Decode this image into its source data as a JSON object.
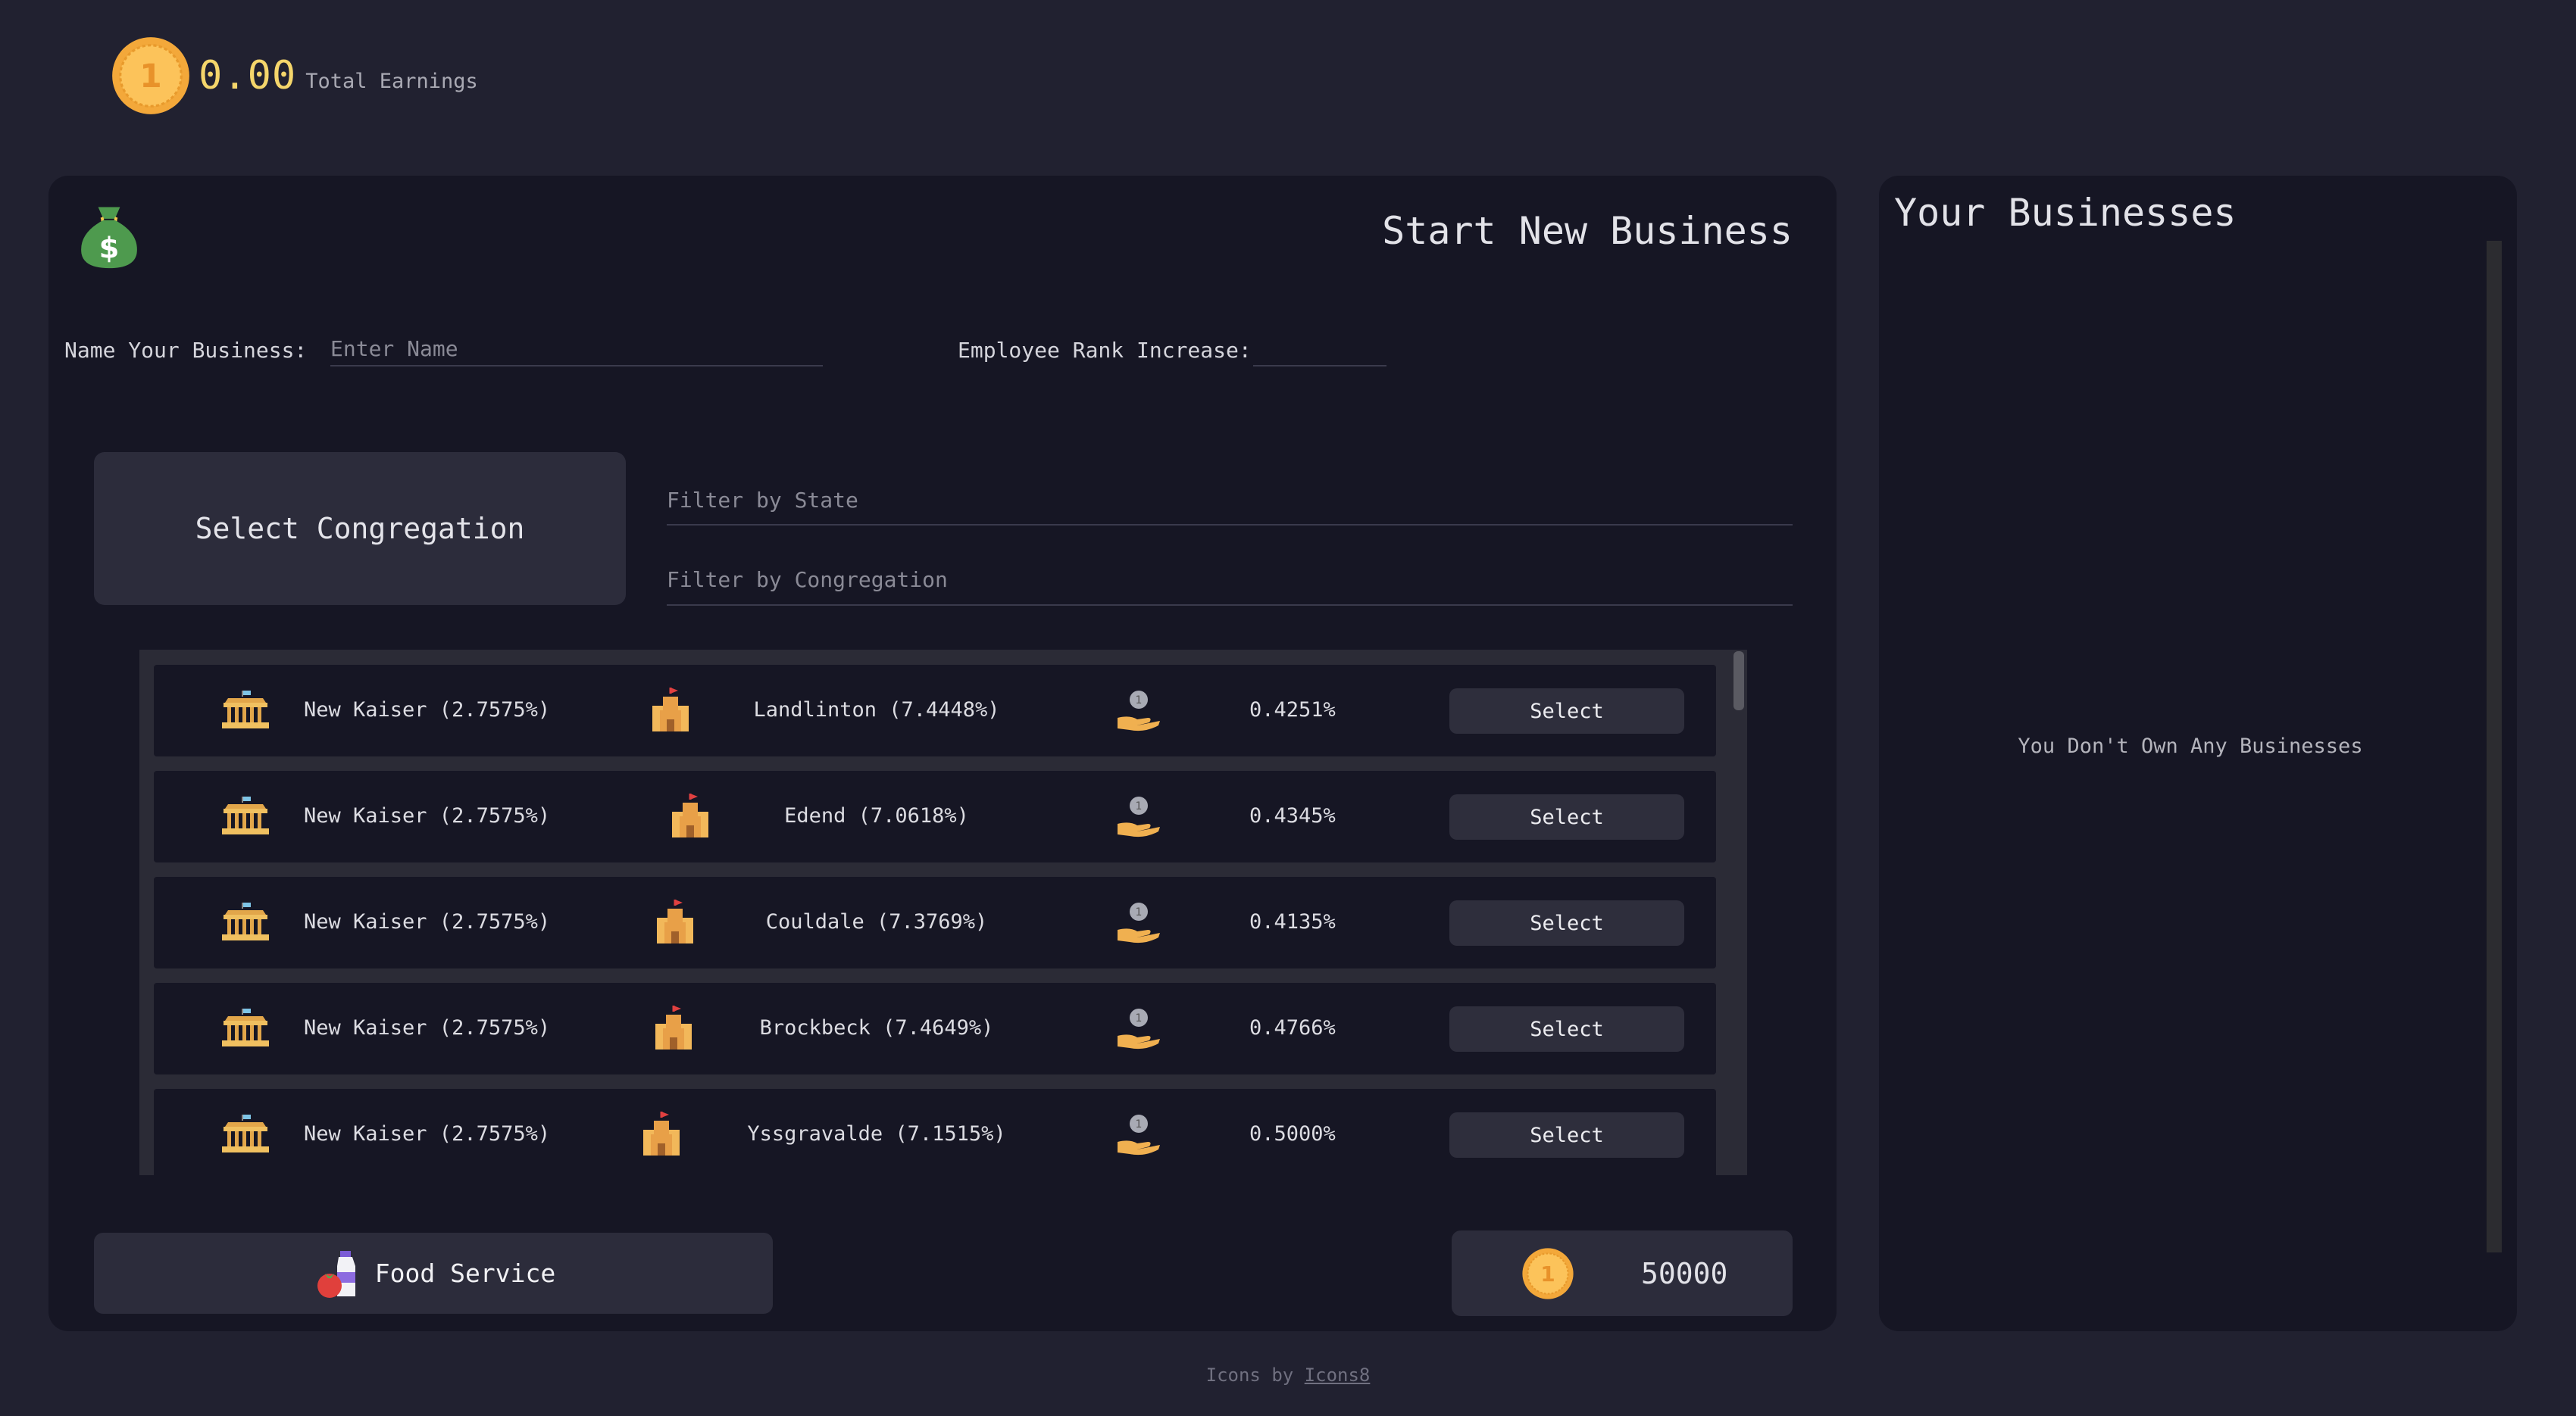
{
  "earnings": {
    "amount": "0.00",
    "label": "Total Earnings",
    "coin_icon": "coin-icon"
  },
  "start": {
    "title": "Start New Business",
    "name_label": "Name Your Business:",
    "name_placeholder": "Enter Name",
    "name_value": "",
    "rank_label": "Employee Rank Increase:",
    "rank_value": "",
    "congregation_button": "Select Congregation",
    "filter_state_placeholder": "Filter by State",
    "filter_congregation_placeholder": "Filter by Congregation",
    "rows": [
      {
        "state": "New Kaiser (2.7575%)",
        "congregation": "Landlinton (7.4448%)",
        "rate": "0.4251%",
        "action": "Select"
      },
      {
        "state": "New Kaiser (2.7575%)",
        "congregation": "Edend (7.0618%)",
        "rate": "0.4345%",
        "action": "Select"
      },
      {
        "state": "New Kaiser (2.7575%)",
        "congregation": "Couldale (7.3769%)",
        "rate": "0.4135%",
        "action": "Select"
      },
      {
        "state": "New Kaiser (2.7575%)",
        "congregation": "Brockbeck (7.4649%)",
        "rate": "0.4766%",
        "action": "Select"
      },
      {
        "state": "New Kaiser (2.7575%)",
        "congregation": "Yssgravalde (7.1515%)",
        "rate": "0.5000%",
        "action": "Select"
      }
    ],
    "business_type": "Food Service",
    "price": "50000"
  },
  "your_businesses": {
    "title": "Your Businesses",
    "empty_message": "You Don't Own Any Businesses"
  },
  "footer": {
    "prefix": "Icons by",
    "link": "Icons8"
  },
  "colors": {
    "background": "#212130",
    "panel": "#161624",
    "button": "#2c2c3b",
    "accent_gold": "#f5d66b"
  },
  "icons": [
    "money-bag-icon",
    "capitol-icon",
    "castle-icon",
    "coin-hand-icon",
    "food-icon",
    "coin-icon"
  ]
}
